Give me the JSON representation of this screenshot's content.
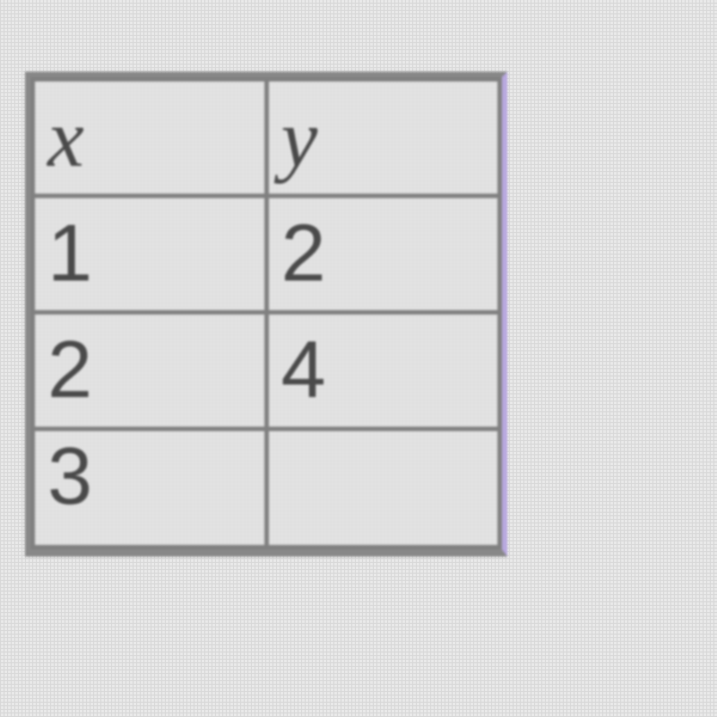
{
  "table": {
    "headers": {
      "col1": "x",
      "col2": "y"
    },
    "rows": [
      {
        "x": "1",
        "y": "2"
      },
      {
        "x": "2",
        "y": "4"
      },
      {
        "x": "3",
        "y": ""
      }
    ]
  }
}
